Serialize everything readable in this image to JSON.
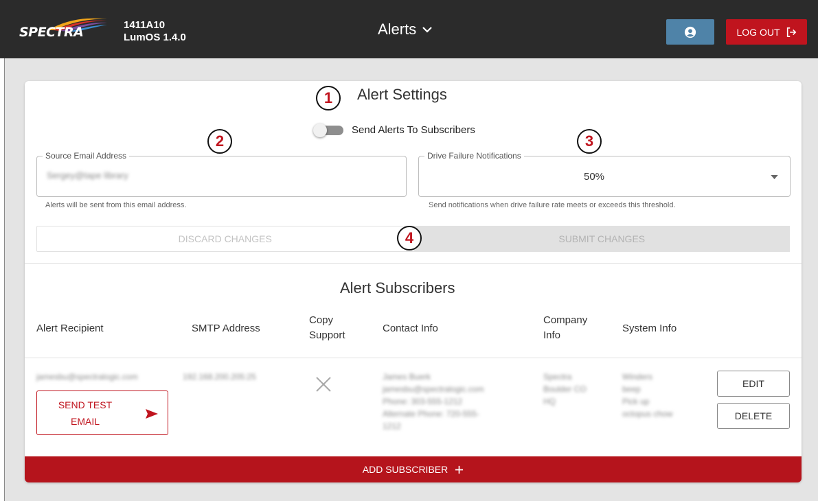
{
  "header": {
    "logo_text": "SPECTRA",
    "model": "1411A10",
    "os_version": "LumOS 1.4.0",
    "page_title": "Alerts",
    "logout_label": "LOG OUT"
  },
  "settings": {
    "title": "Alert Settings",
    "toggle_label": "Send Alerts To Subscribers",
    "toggle_on": false,
    "email_field": {
      "label": "Source Email Address",
      "value": "Sergey@tape library",
      "helper": "Alerts will be sent from this email address."
    },
    "drive_field": {
      "label": "Drive Failure Notifications",
      "value": "50%",
      "helper": "Send notifications when drive failure rate meets or exceeds this threshold."
    },
    "discard_label": "DISCARD CHANGES",
    "submit_label": "SUBMIT CHANGES"
  },
  "callouts": [
    "1",
    "2",
    "3",
    "4"
  ],
  "subscribers": {
    "title": "Alert Subscribers",
    "columns": {
      "recipient": "Alert Recipient",
      "smtp": "SMTP Address",
      "copy_support_1": "Copy",
      "copy_support_2": "Support",
      "contact": "Contact Info",
      "company_1": "Company",
      "company_2": "Info",
      "system": "System Info"
    },
    "rows": [
      {
        "recipient": "jamesbu@spectralogic.com",
        "smtp": "192.168.200.205:25",
        "copy_support": "x-mark-icon",
        "contact": [
          "James Buerk",
          "jamesbu@spectralogic.com",
          "Phone: 303-555-1212",
          "Alternate Phone: 720-555-",
          "1212"
        ],
        "company": [
          "Spectra",
          "Boulder CO",
          "HQ"
        ],
        "system": [
          "Winders",
          "beep",
          "Pick up",
          "octopus chow"
        ],
        "send_test_label": "SEND TEST EMAIL",
        "edit_label": "EDIT",
        "delete_label": "DELETE"
      }
    ],
    "add_label": "ADD SUBSCRIBER"
  },
  "colors": {
    "brand_red": "#c0141e",
    "header_bg": "#2b2b2b",
    "user_button": "#4f83a8",
    "page_bg": "#e4e4e4"
  }
}
